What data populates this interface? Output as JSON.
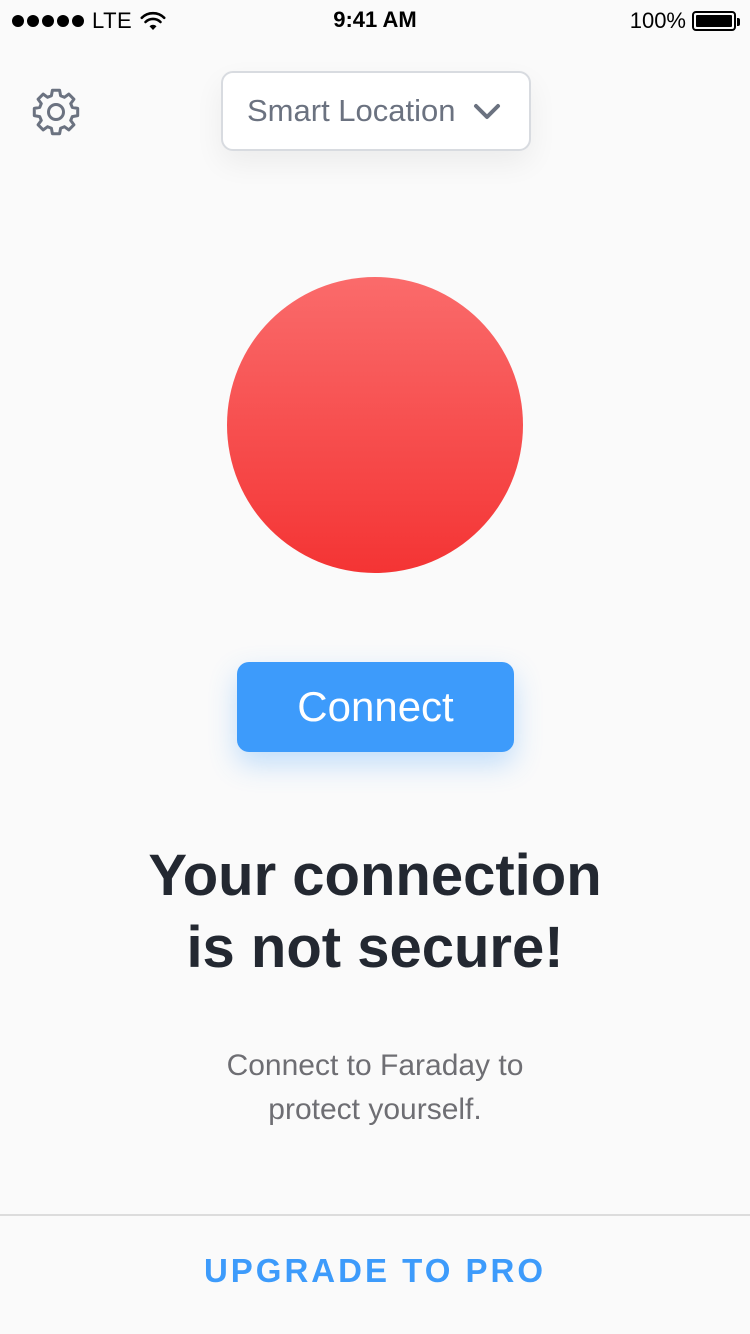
{
  "status_bar": {
    "carrier": "LTE",
    "time": "9:41 AM",
    "battery_percent": "100%",
    "signal_bars": 5,
    "icons": [
      "signal-dots-icon",
      "wifi-icon",
      "battery-icon"
    ]
  },
  "header": {
    "settings_icon": "gear-icon",
    "location_selector": {
      "label": "Smart Location",
      "icon": "chevron-down-icon"
    }
  },
  "status": {
    "indicator_color": "#f44848",
    "connect_label": "Connect",
    "headline_line1": "Your connection",
    "headline_line2": "is not secure!",
    "subtext_line1": "Connect to Faraday to",
    "subtext_line2": "protect yourself."
  },
  "footer": {
    "upgrade_label": "UPGRADE TO PRO"
  },
  "colors": {
    "accent": "#3d9bfb",
    "danger": "#f44848",
    "text_dark": "#232831",
    "text_muted": "#6e6e73",
    "background": "#fafafa"
  }
}
